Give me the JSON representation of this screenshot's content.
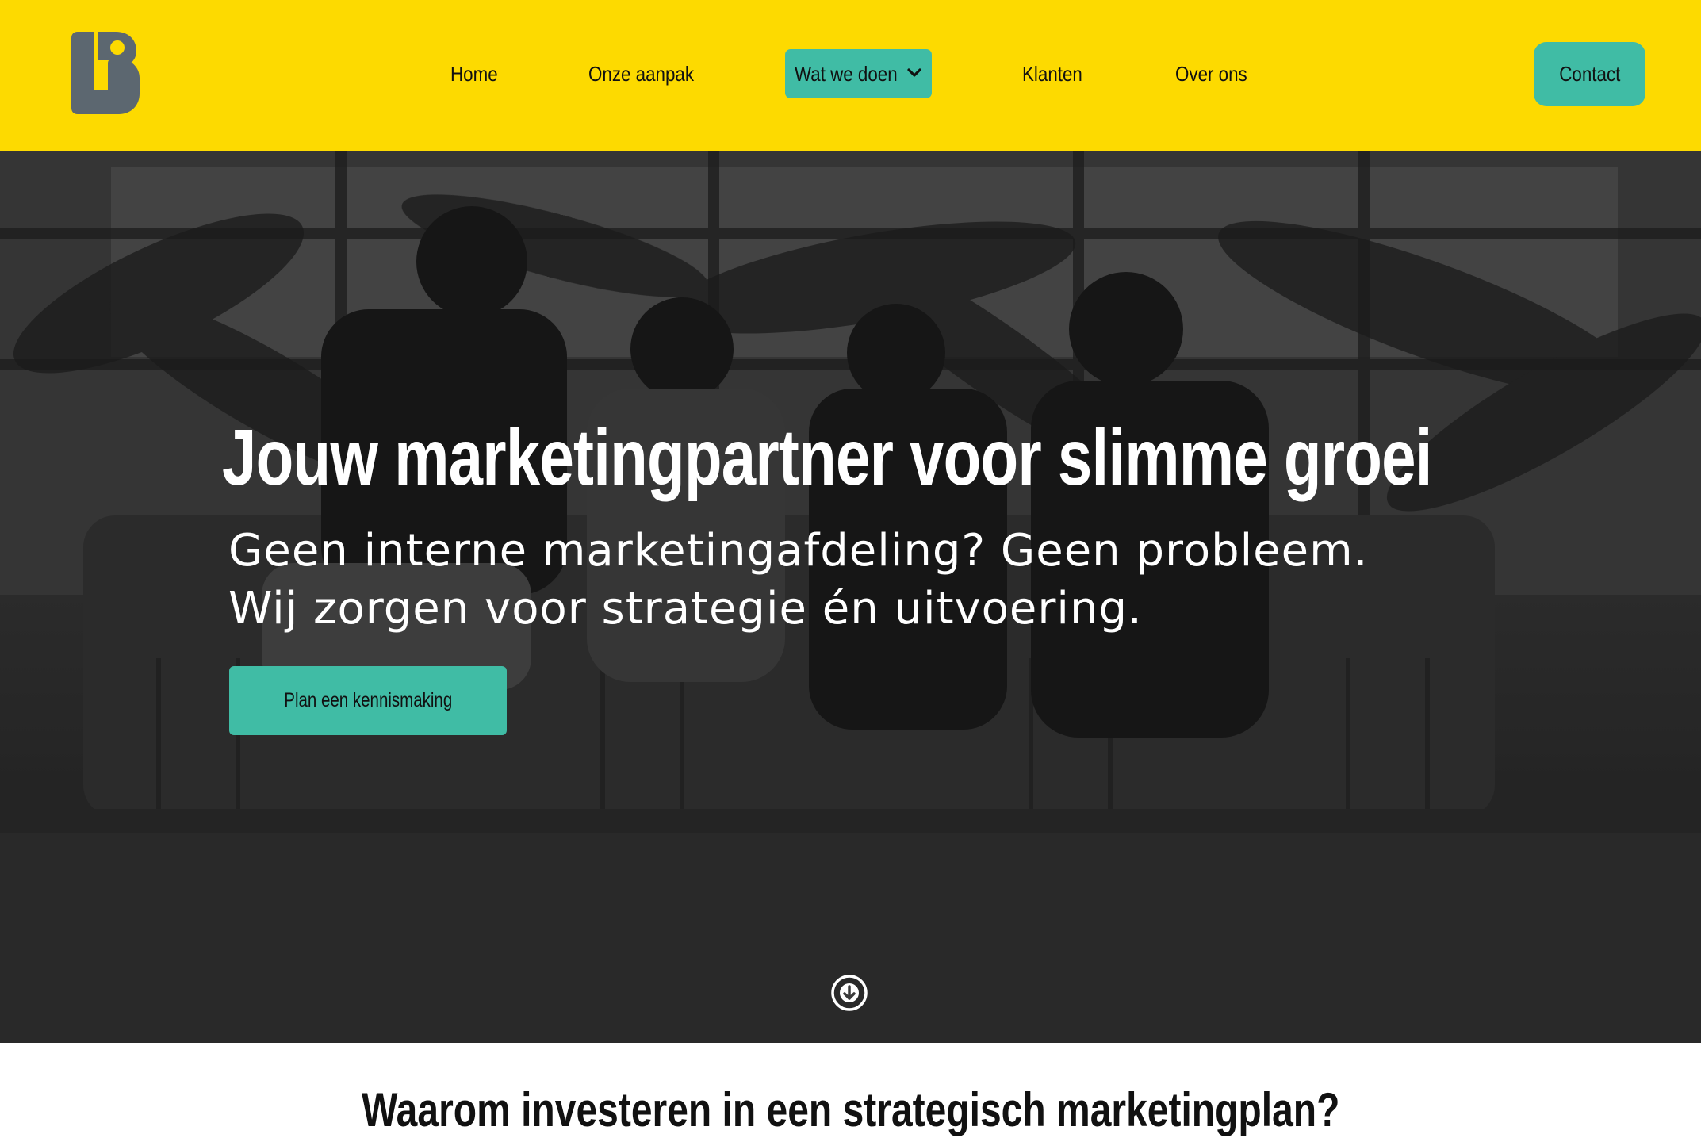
{
  "brand": {
    "logo_alt": "LB",
    "primary_color": "#FDDA00",
    "accent_color": "#40BCA5",
    "logo_color": "#5C6770"
  },
  "nav": {
    "items": [
      {
        "label": "Home"
      },
      {
        "label": "Onze aanpak"
      },
      {
        "label": "Wat we doen",
        "active": true,
        "has_dropdown": true
      },
      {
        "label": "Klanten"
      },
      {
        "label": "Over ons"
      }
    ],
    "contact_label": "Contact"
  },
  "hero": {
    "title": "Jouw marketingpartner voor slimme groei",
    "subtitle_line1": "Geen interne marketingafdeling? Geen probleem.",
    "subtitle_line2": "Wij zorgen voor strategie én uitvoering.",
    "cta_label": "Plan een kennismaking",
    "scroll_icon": "arrow-down-circle-icon"
  },
  "section": {
    "title": "Waarom investeren in een strategisch marketingplan?"
  }
}
